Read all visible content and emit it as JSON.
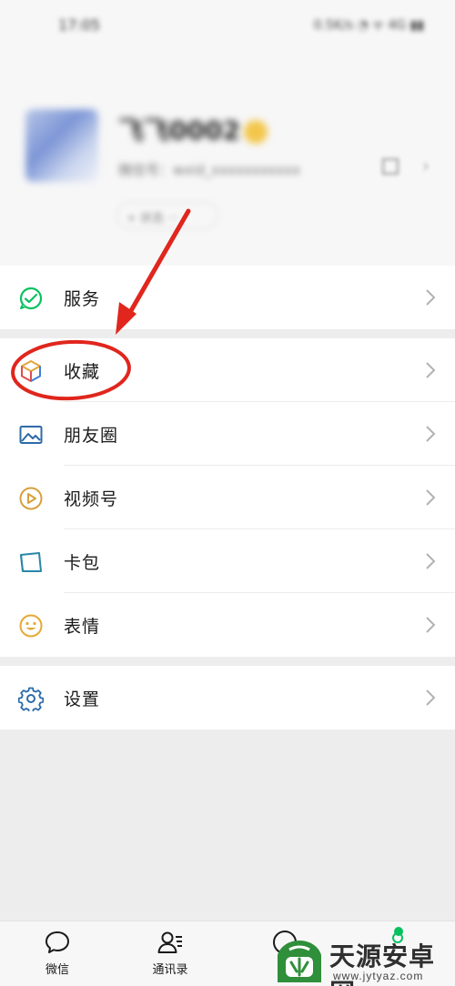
{
  "status_bar": {
    "time": "17:05",
    "icons_text": "0.5K/s ◔ ᯤ 4G ▮▮"
  },
  "profile": {
    "nickname": "飞飞0002",
    "wxid": "微信号：wxid_xxxxxxxxxxx",
    "status_label": "+ 状态  ···"
  },
  "menu": {
    "services": {
      "label": "服务",
      "icon": "wechat-pay-icon",
      "color": "#07c160"
    },
    "favorites": {
      "label": "收藏",
      "icon": "cube-icon"
    },
    "moments": {
      "label": "朋友圈",
      "icon": "image-icon",
      "color": "#2d6ba7"
    },
    "channels": {
      "label": "视频号",
      "icon": "play-circle-icon",
      "color": "#d8a03d"
    },
    "cards": {
      "label": "卡包",
      "icon": "card-icon",
      "color": "#2b86a8"
    },
    "stickers": {
      "label": "表情",
      "icon": "smile-icon",
      "color": "#e5a935"
    },
    "settings": {
      "label": "设置",
      "icon": "gear-icon",
      "color": "#2b6aa8"
    }
  },
  "tabbar": {
    "tabs": [
      {
        "label": "微信",
        "icon": "chat-bubble-icon"
      },
      {
        "label": "通讯录",
        "icon": "contacts-icon"
      },
      {
        "label": "",
        "icon": "compass-icon"
      },
      {
        "label": "",
        "icon": "person-icon"
      }
    ]
  },
  "annotation": {
    "color": "#e0261d"
  },
  "watermark": {
    "title": "天源安卓网",
    "url": "www.jytyaz.com"
  }
}
